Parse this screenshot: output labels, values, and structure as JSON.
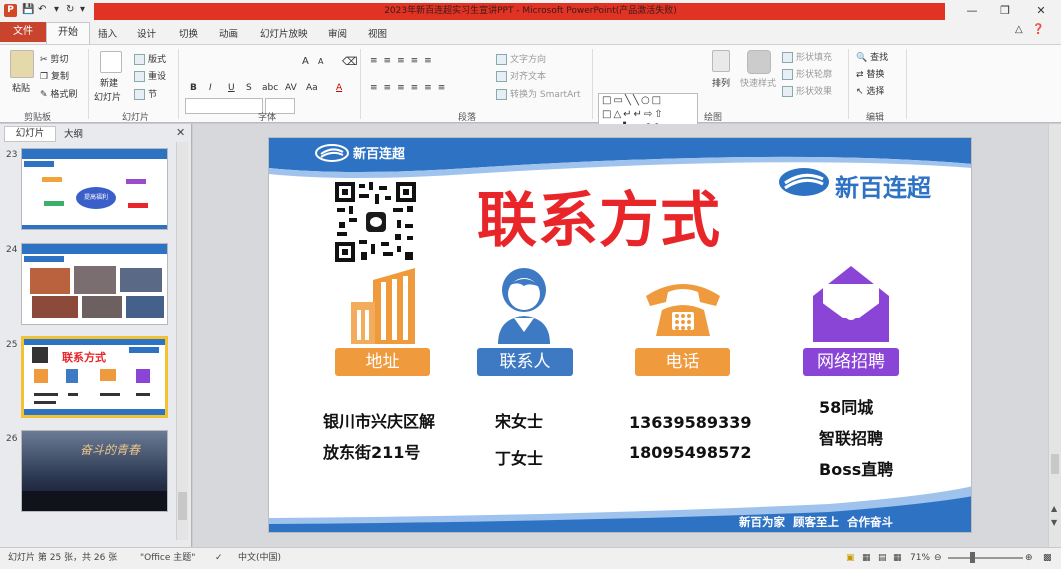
{
  "window": {
    "title": "2023年新百连超实习生宣讲PPT - Microsoft PowerPoint(产品激活失败)",
    "app_icon": "P"
  },
  "tabs": [
    "文件",
    "开始",
    "插入",
    "设计",
    "切换",
    "动画",
    "幻灯片放映",
    "审阅",
    "视图"
  ],
  "ribbon": {
    "clipboard": {
      "paste": "粘贴",
      "cut": "剪切",
      "copy": "复制",
      "format_painter": "格式刷",
      "group": "剪贴板"
    },
    "slides": {
      "new_slide": "新建",
      "new_slide2": "幻灯片",
      "layout": "版式",
      "reset": "重设",
      "section": "节",
      "group": "幻灯片"
    },
    "font": {
      "group": "字体",
      "bold": "B",
      "italic": "I",
      "underline": "U",
      "strike": "S",
      "shadow": "abc",
      "spacing": "AV",
      "case": "Aa",
      "color": "A",
      "grow": "A",
      "shrink": "A"
    },
    "paragraph": {
      "text_direction": "文字方向",
      "align_text": "对齐文本",
      "smartart": "转换为 SmartArt",
      "group": "段落"
    },
    "drawing": {
      "arrange": "排列",
      "quick_styles": "快速样式",
      "shape_fill": "形状填充",
      "shape_outline": "形状轮廓",
      "shape_effects": "形状效果",
      "group": "绘图"
    },
    "editing": {
      "find": "查找",
      "replace": "替换",
      "select": "选择",
      "group": "编辑"
    }
  },
  "left_panel": {
    "tabs": [
      "幻灯片",
      "大纲"
    ],
    "slides": [
      {
        "num": "23",
        "label": "提高福利"
      },
      {
        "num": "24",
        "label": "团建活动照片"
      },
      {
        "num": "25",
        "label": "联系方式",
        "selected": true
      },
      {
        "num": "26",
        "label": "奋斗的青春"
      }
    ]
  },
  "slide": {
    "brand_small": "新百连超",
    "brand_big": "新百连超",
    "title": "联系方式",
    "items": [
      {
        "caption": "地址",
        "lines": [
          "银川市兴庆区解",
          "放东街211号"
        ],
        "color": "#f09a3e"
      },
      {
        "caption": "联系人",
        "lines": [
          "宋女士",
          "丁女士"
        ],
        "color": "#3e7ac4"
      },
      {
        "caption": "电话",
        "lines": [
          "13639589339",
          "18095498572"
        ],
        "color": "#f09a3e"
      },
      {
        "caption": "网络招聘",
        "lines": [
          "58同城",
          "智联招聘",
          "Boss直聘"
        ],
        "color": "#8a45d6"
      }
    ],
    "footer": "新百为家  顾客至上  合作奋斗",
    "colors": {
      "blue": "#2e72c4",
      "red": "#e8262a",
      "orange": "#f09a3e",
      "purple": "#8a45d6"
    }
  },
  "status": {
    "slide_pos": "幻灯片 第 25 张，共 26 张",
    "theme": "\"Office 主题\"",
    "lang": "中文(中国)",
    "zoom": "71%"
  }
}
